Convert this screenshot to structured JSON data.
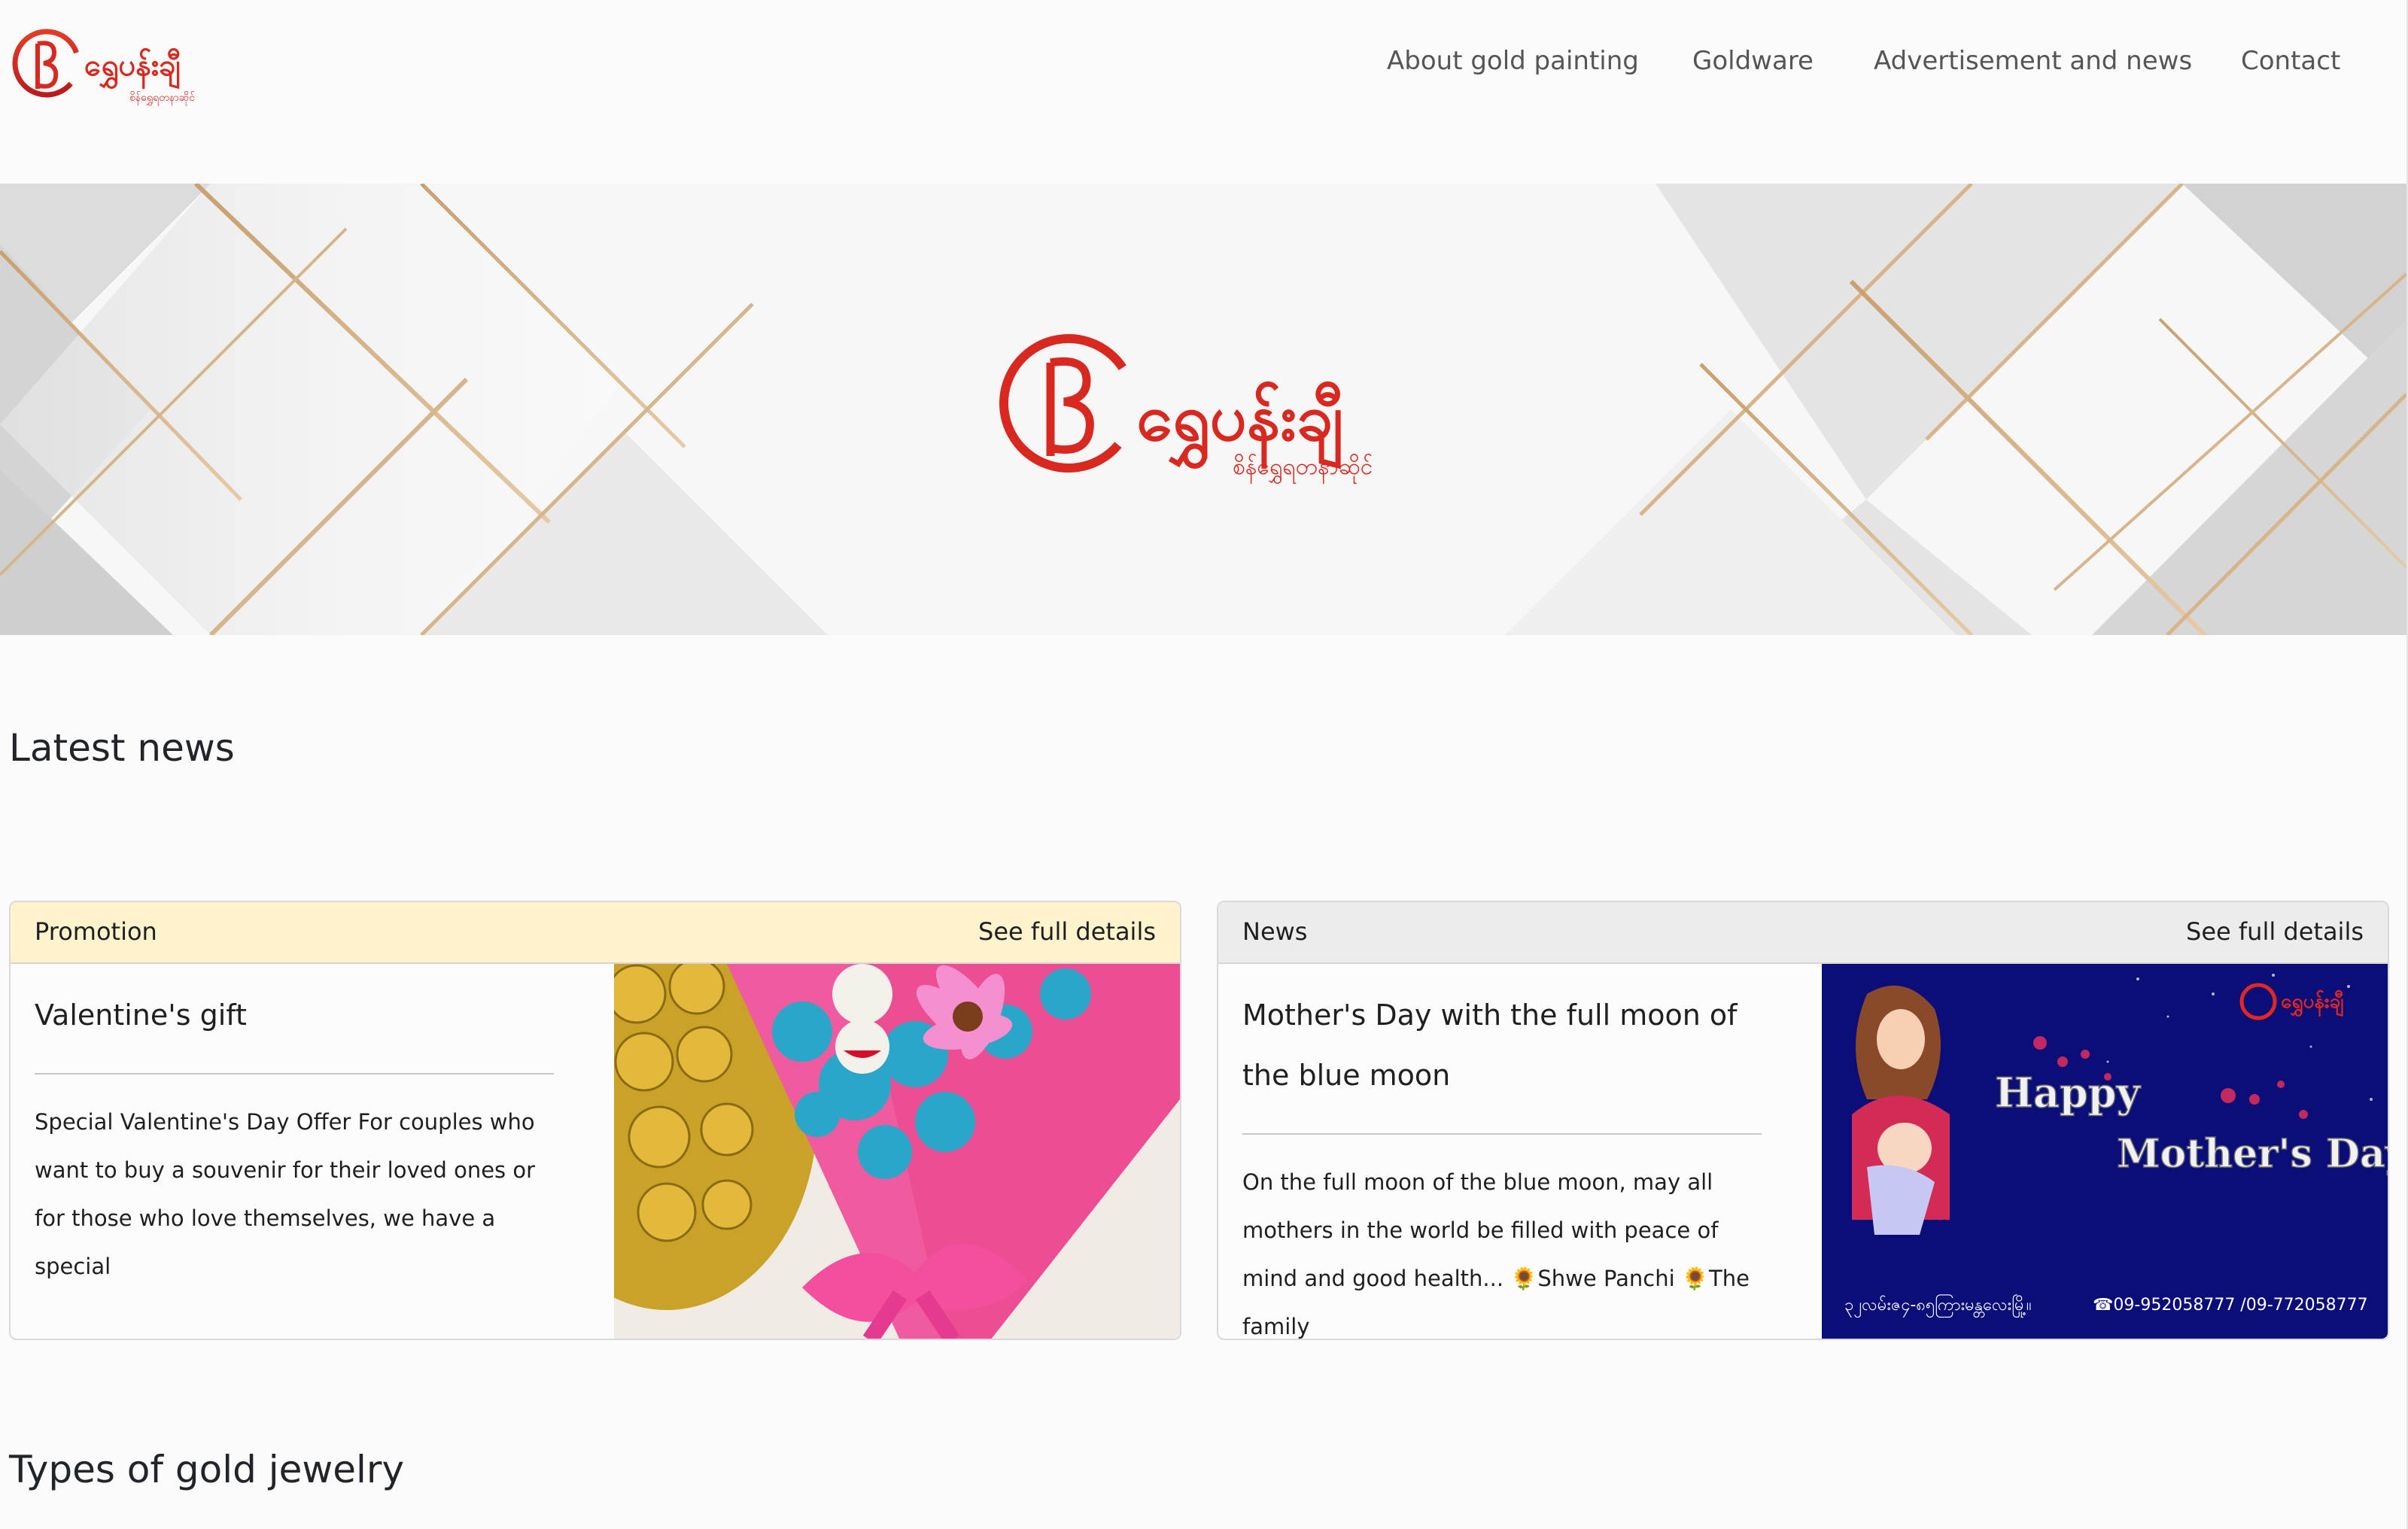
{
  "header": {
    "logo_text": "ရွှေပန်းချီ",
    "nav": [
      {
        "label": "About gold painting"
      },
      {
        "label": "Goldware"
      },
      {
        "label": "Advertisement and news"
      },
      {
        "label": "Contact"
      }
    ]
  },
  "banner": {
    "logo_text": "ရွှေပန်းချီ",
    "logo_subtext": "စိန်ရွှေရတနာဆိုင်"
  },
  "latest_news": {
    "title": "Latest news",
    "cards": [
      {
        "category": "Promotion",
        "more_label": "See full details",
        "title": "Valentine's gift",
        "body": "Special Valentine's Day Offer For couples who want to buy a souvenir for their loved ones or for those who love themselves, we have a special"
      },
      {
        "category": "News",
        "more_label": "See full details",
        "title": "Mother's Day with the full moon of the blue moon",
        "body": "On the full moon of the blue moon, may all mothers in the world be filled with peace of mind and good health... 🌻Shwe Panchi 🌻The family",
        "image": {
          "headline_1": "Happy",
          "headline_2": "Mother's Day",
          "footer_address": "၃၂လမ်းဇ၄-၈၅ကြားမန္တလေးမြို့။",
          "footer_phone": "☎09-952058777 /09-772058777"
        }
      }
    ]
  },
  "jewelry": {
    "title": "Types of gold jewelry"
  },
  "colors": {
    "promotion_header_bg": "#fff3cd",
    "news_header_bg": "#ececec",
    "logo_red": "#d8281f",
    "mothers_day_bg": "#0b0d78"
  }
}
